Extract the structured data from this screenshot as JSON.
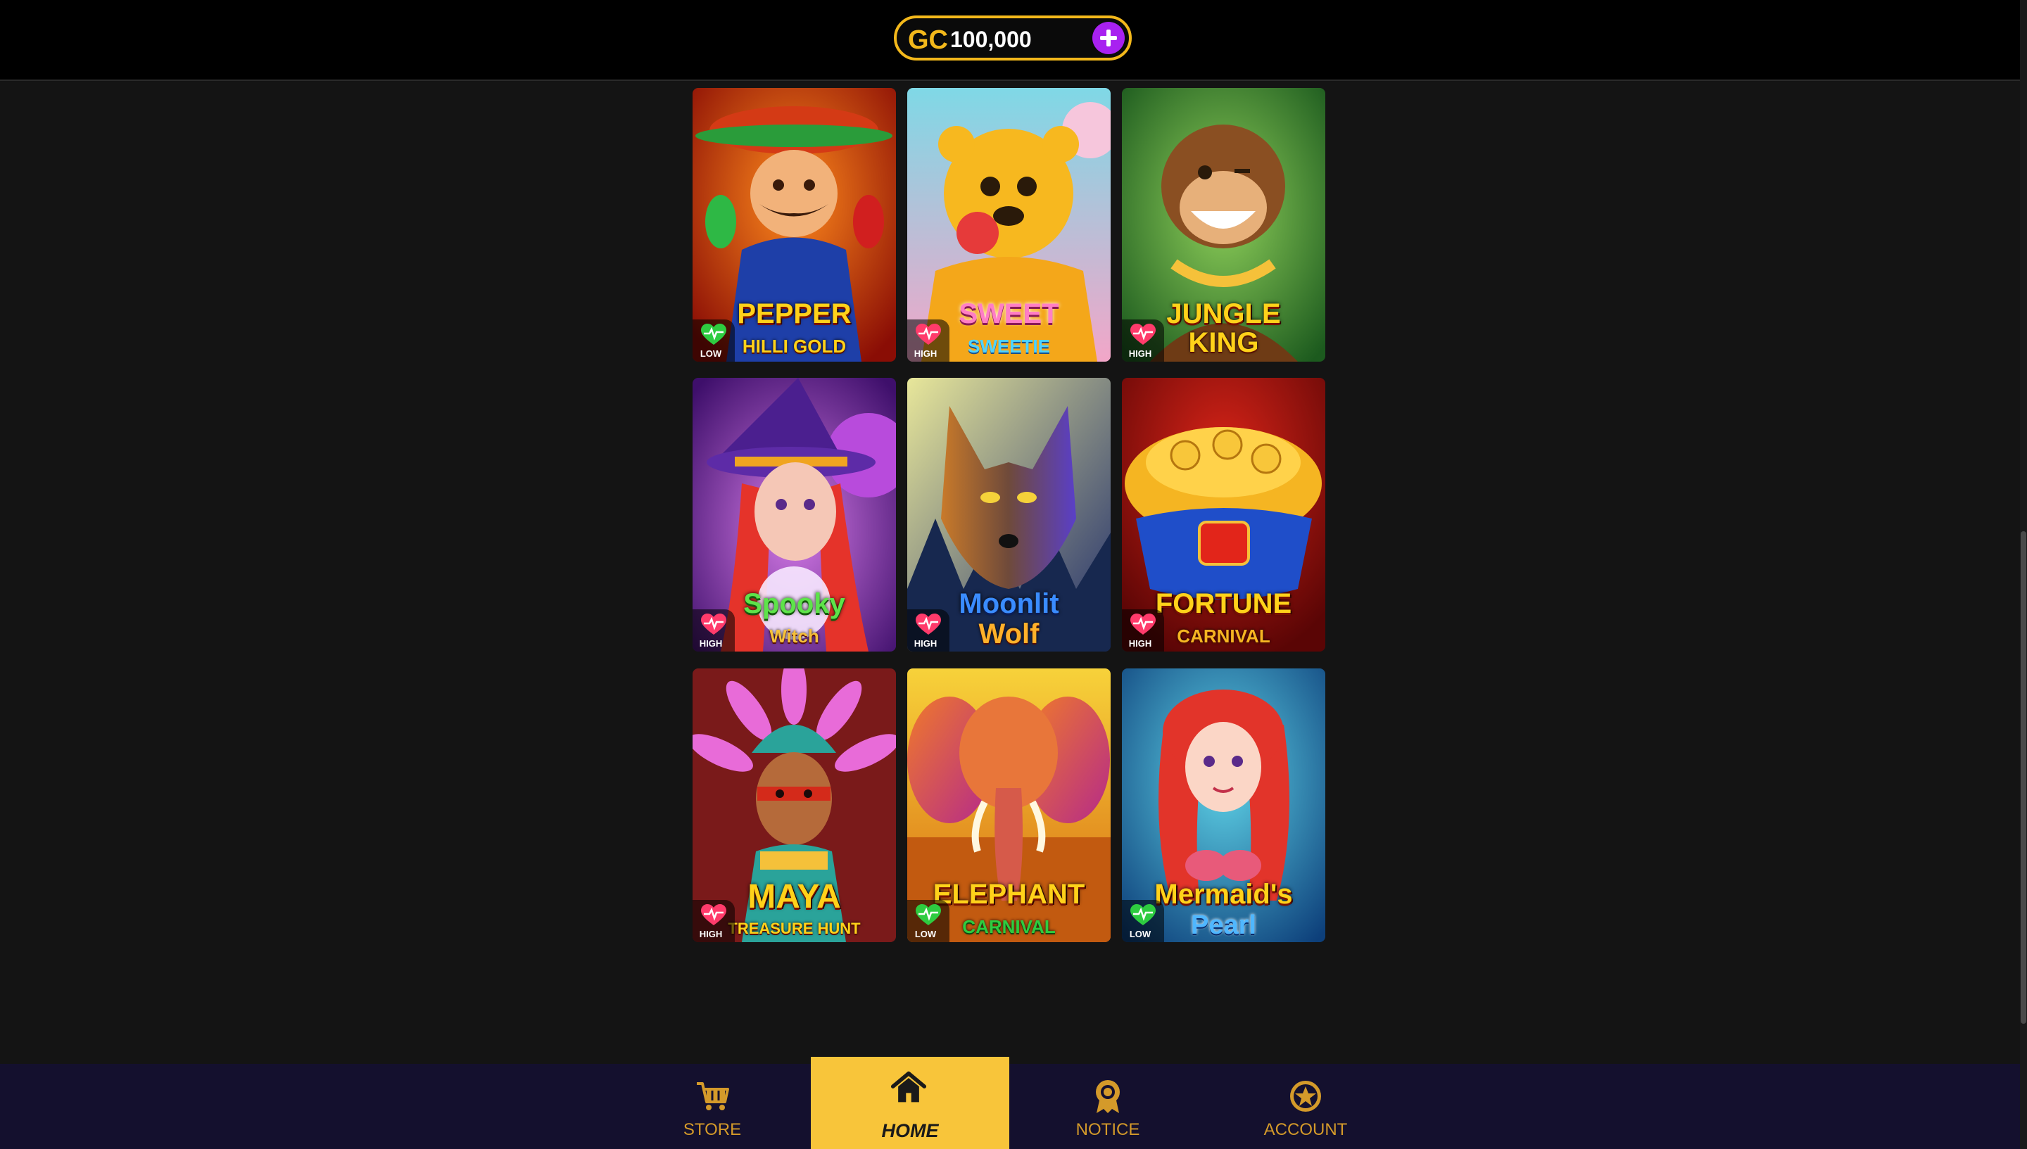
{
  "header": {
    "currency": "GC",
    "balance": "100,000"
  },
  "games": [
    {
      "title": "PEPPER",
      "subtitle": "HILLI GOLD",
      "volatility": "LOW",
      "vol_color": "#2ecc40"
    },
    {
      "title": "SWEET",
      "subtitle": "SWEETIE",
      "volatility": "HIGH",
      "vol_color": "#ff3b6b"
    },
    {
      "title": "JUNGLE",
      "subtitle": "KING",
      "volatility": "HIGH",
      "vol_color": "#ff3b6b"
    },
    {
      "title": "Spooky",
      "subtitle": "Witch",
      "volatility": "HIGH",
      "vol_color": "#ff3b6b"
    },
    {
      "title": "Moonlit",
      "subtitle": "Wolf",
      "volatility": "HIGH",
      "vol_color": "#ff3b6b"
    },
    {
      "title": "FORTUNE",
      "subtitle": "CARNIVAL",
      "volatility": "HIGH",
      "vol_color": "#ff3b6b"
    },
    {
      "title": "MAYA",
      "subtitle": "TREASURE HUNT",
      "volatility": "HIGH",
      "vol_color": "#ff3b6b"
    },
    {
      "title": "ELEPHANT",
      "subtitle": "CARNIVAL",
      "volatility": "LOW",
      "vol_color": "#2ecc40"
    },
    {
      "title": "Mermaid's",
      "subtitle": "Pearl",
      "volatility": "LOW",
      "vol_color": "#2ecc40"
    }
  ],
  "nav": {
    "store": "STORE",
    "home": "HOME",
    "notice": "NOTICE",
    "account": "ACCOUNT"
  },
  "colors": {
    "accent": "#f3b81b",
    "plus_button": "#a821f0",
    "nav_bg": "#14102e",
    "nav_active": "#f8c53a"
  }
}
